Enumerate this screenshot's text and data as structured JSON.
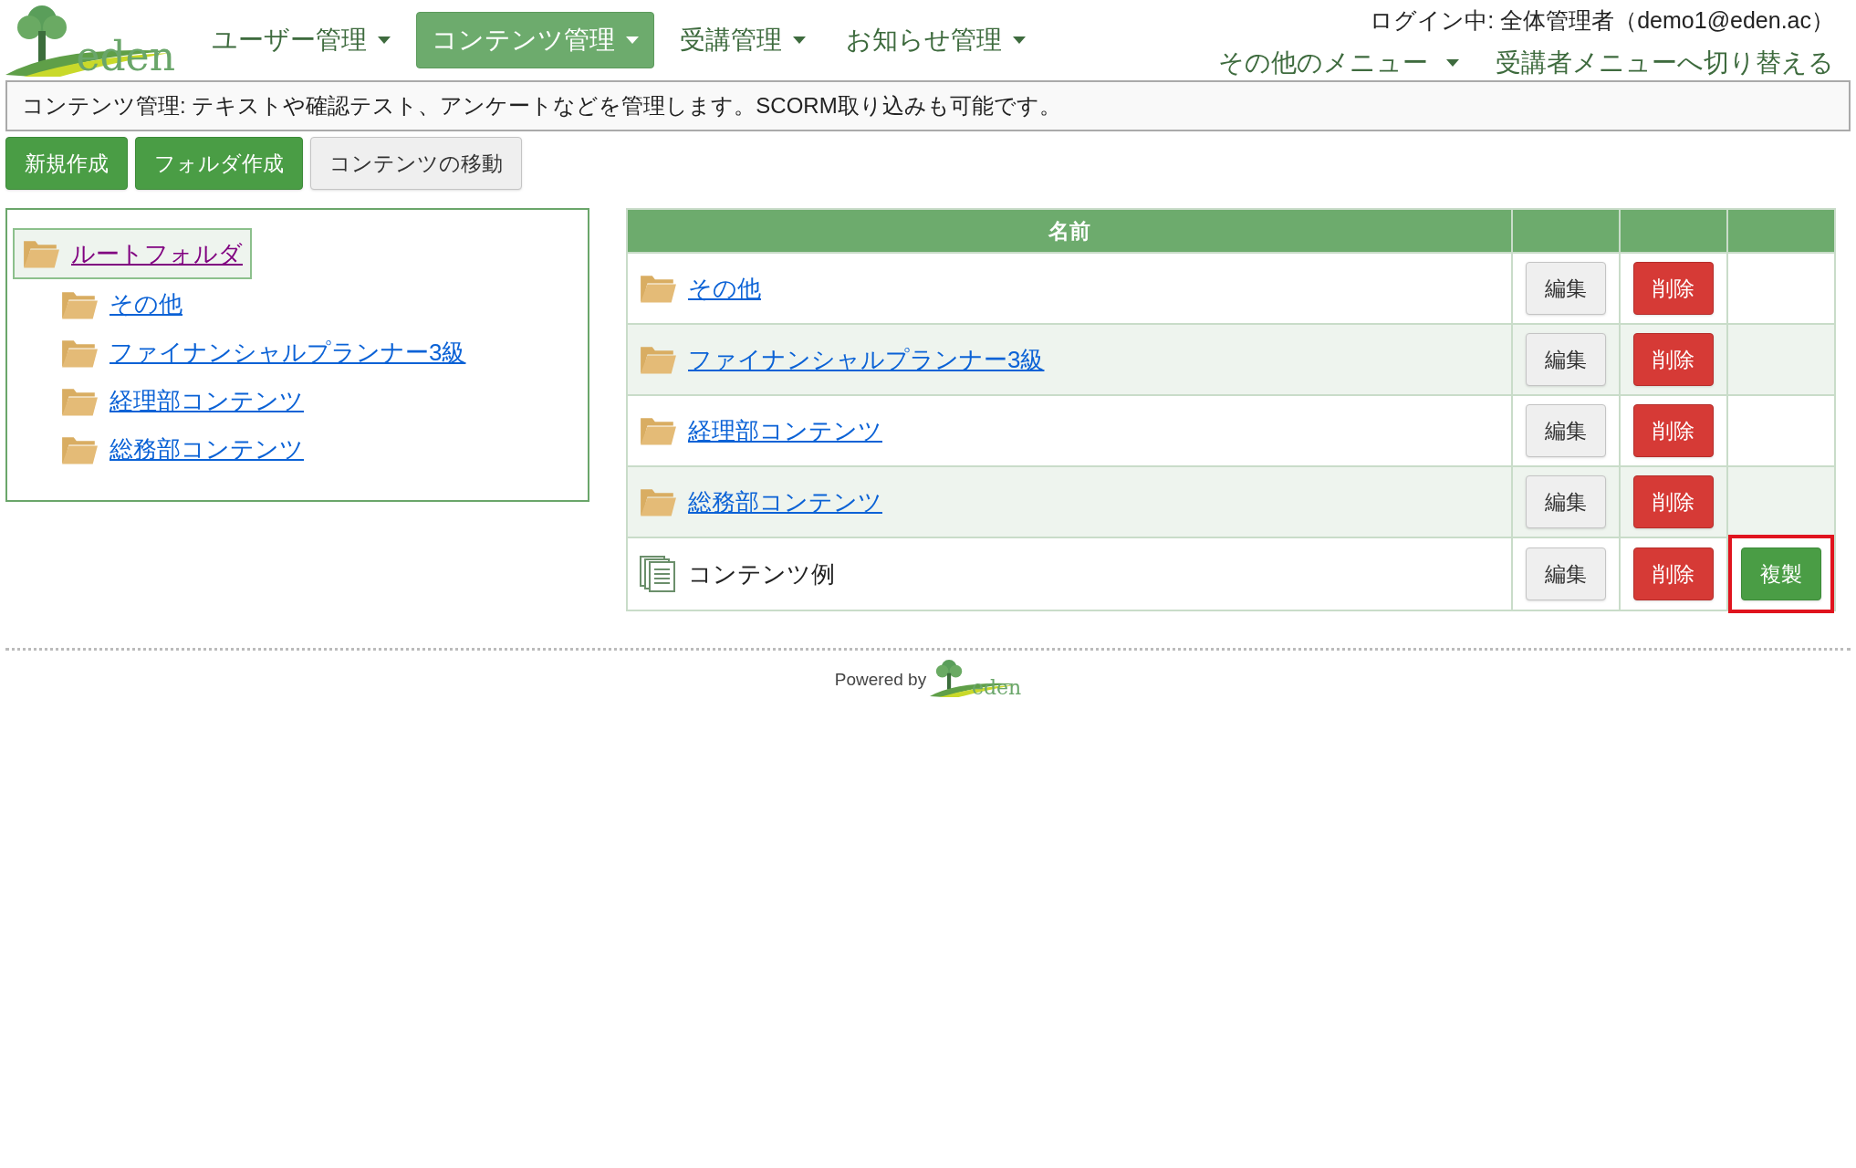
{
  "header": {
    "logo_text": "eden",
    "nav": [
      {
        "label": "ユーザー管理",
        "selected": false
      },
      {
        "label": "コンテンツ管理",
        "selected": true
      },
      {
        "label": "受講管理",
        "selected": false
      },
      {
        "label": "お知らせ管理",
        "selected": false
      }
    ],
    "login": "ログイン中: 全体管理者（demo1@eden.ac）",
    "other_menu": "その他のメニュー",
    "switch_link": "受講者メニューへ切り替える"
  },
  "description": "コンテンツ管理: テキストや確認テスト、アンケートなどを管理します。SCORM取り込みも可能です。",
  "actions": [
    {
      "label": "新規作成",
      "kind": "primary"
    },
    {
      "label": "フォルダ作成",
      "kind": "primary"
    },
    {
      "label": "コンテンツの移動",
      "kind": "default"
    }
  ],
  "tree": {
    "label": "ルートフォルダ",
    "selected": true,
    "children": [
      {
        "label": "その他",
        "selected": false
      },
      {
        "label": "ファイナンシャルプランナー3級",
        "selected": false
      },
      {
        "label": "経理部コンテンツ",
        "selected": false
      },
      {
        "label": "総務部コンテンツ",
        "selected": false
      }
    ]
  },
  "table": {
    "columns": [
      "名前"
    ],
    "rows": [
      {
        "kind": "folder",
        "name": "その他",
        "edit": "編集",
        "delete": "削除"
      },
      {
        "kind": "folder",
        "name": "ファイナンシャルプランナー3級",
        "edit": "編集",
        "delete": "削除"
      },
      {
        "kind": "folder",
        "name": "経理部コンテンツ",
        "edit": "編集",
        "delete": "削除"
      },
      {
        "kind": "folder",
        "name": "総務部コンテンツ",
        "edit": "編集",
        "delete": "削除"
      },
      {
        "kind": "content",
        "name": "コンテンツ例",
        "edit": "編集",
        "delete": "削除",
        "copy": "複製",
        "highlighted": true
      }
    ]
  },
  "footer": {
    "powered_by": "Powered by",
    "logo_text": "eden"
  }
}
